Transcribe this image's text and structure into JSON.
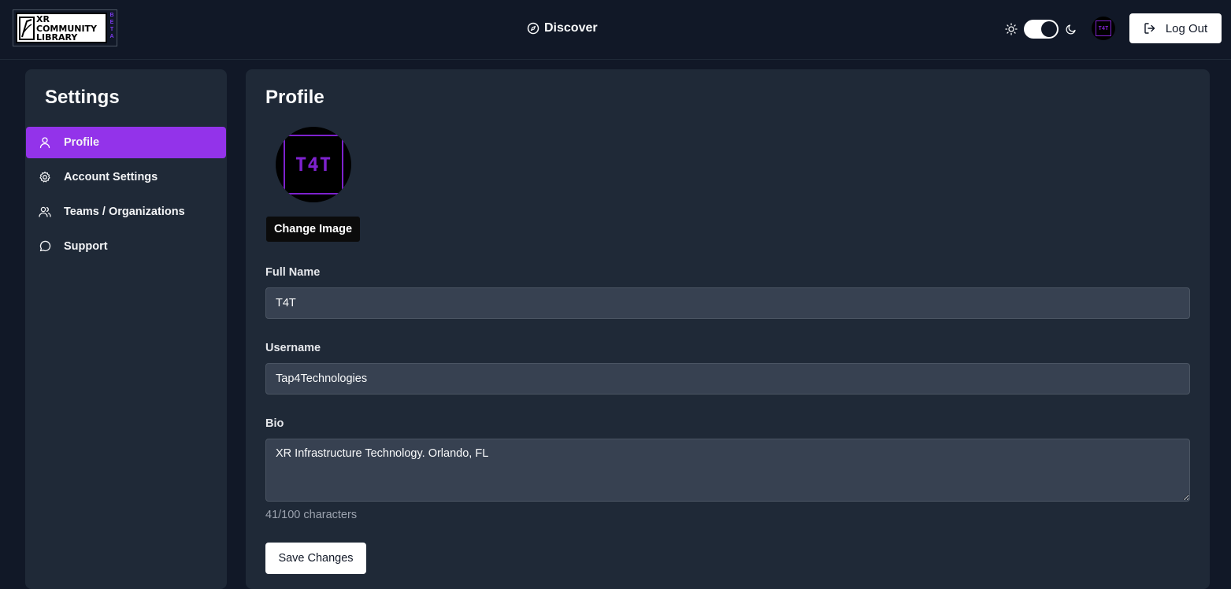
{
  "header": {
    "logo": {
      "line1": "XR",
      "line2": "COMMUNITY",
      "line3": "LIBRARY",
      "beta": [
        "B",
        "E",
        "T",
        "A"
      ]
    },
    "discover_label": "Discover",
    "theme_toggle": {
      "state": "dark"
    },
    "avatar_text": "T4T",
    "logout_label": "Log Out"
  },
  "sidebar": {
    "title": "Settings",
    "items": [
      {
        "label": "Profile",
        "icon": "user-icon",
        "active": true
      },
      {
        "label": "Account Settings",
        "icon": "gear-icon",
        "active": false
      },
      {
        "label": "Teams / Organizations",
        "icon": "users-icon",
        "active": false
      },
      {
        "label": "Support",
        "icon": "message-circle-icon",
        "active": false
      }
    ]
  },
  "main": {
    "title": "Profile",
    "avatar_text": "T4T",
    "change_image_label": "Change Image",
    "full_name": {
      "label": "Full Name",
      "value": "T4T"
    },
    "username": {
      "label": "Username",
      "value": "Tap4Technologies"
    },
    "bio": {
      "label": "Bio",
      "value": "XR Infrastructure Technology. Orlando, FL"
    },
    "char_count": "41/100 characters",
    "save_label": "Save Changes"
  },
  "colors": {
    "background": "#111827",
    "panel": "#1f2937",
    "accent": "#9333ea",
    "input_bg": "#374151"
  }
}
